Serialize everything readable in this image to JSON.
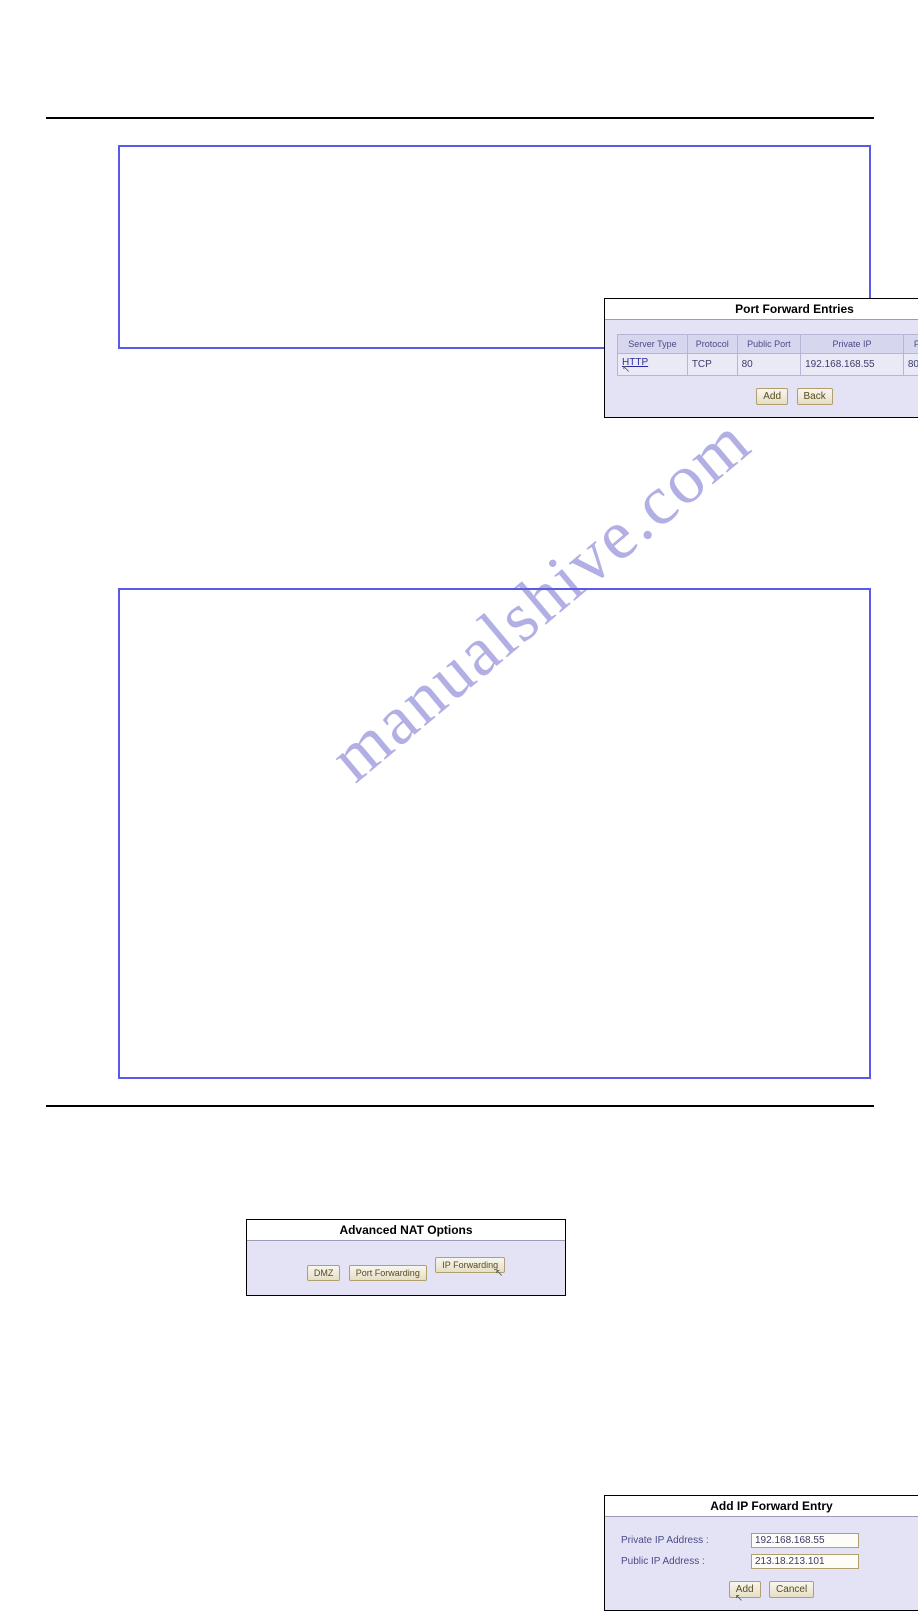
{
  "watermark": "manualshive.com",
  "panel_pf": {
    "title": "Port Forward Entries",
    "headers": [
      "Server Type",
      "Protocol",
      "Public Port",
      "Private IP",
      "Private Port"
    ],
    "row": {
      "server_type": "HTTP",
      "protocol": "TCP",
      "public_port": "80",
      "private_ip": "192.168.168.55",
      "private_port": "80"
    },
    "btn_add": "Add",
    "btn_back": "Back"
  },
  "panel_nat": {
    "title": "Advanced NAT Options",
    "btn_dmz": "DMZ",
    "btn_pf": "Port Forwarding",
    "btn_ipf": "IP Forwarding"
  },
  "panel_ip": {
    "title": "Add IP Forward Entry",
    "lbl_private": "Private IP Address :",
    "lbl_public": "Public IP Address :",
    "val_private": "192.168.168.55",
    "val_public": "213.18.213.101",
    "btn_add": "Add",
    "btn_cancel": "Cancel"
  }
}
